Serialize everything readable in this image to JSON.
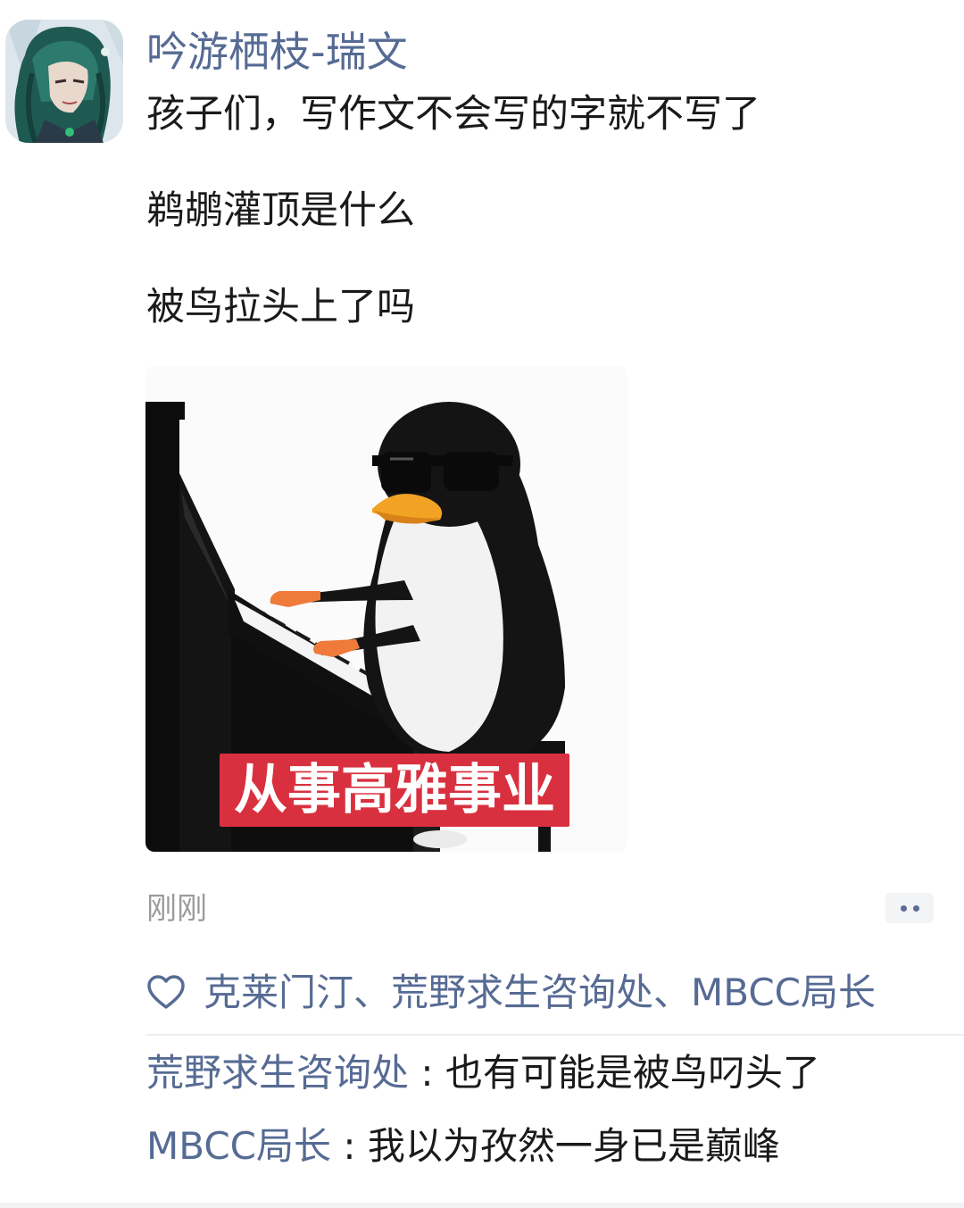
{
  "post": {
    "author": "吟游栖枝-瑞文",
    "lines": [
      "孩子们，写作文不会写的字就不写了",
      "鹈鹕灌顶是什么",
      "被鸟拉头上了吗"
    ],
    "image_caption": "从事高雅事业",
    "timestamp": "刚刚"
  },
  "likes": {
    "names": "克莱门汀、荒野求生咨询处、MBCC局长"
  },
  "comments": [
    {
      "author": "荒野求生咨询处",
      "separator": " : ",
      "text": "也有可能是被鸟叼头了"
    },
    {
      "author": "MBCC局长",
      "separator": " : ",
      "text": "我以为孜然一身已是巅峰"
    }
  ],
  "colors": {
    "name_link": "#566b94",
    "body_text": "#1a1a1a",
    "timestamp": "#9b9b9b",
    "caption_bg": "#d9303f"
  },
  "icons": {
    "heart": "heart-outline-icon",
    "more": "more-dots-icon"
  }
}
